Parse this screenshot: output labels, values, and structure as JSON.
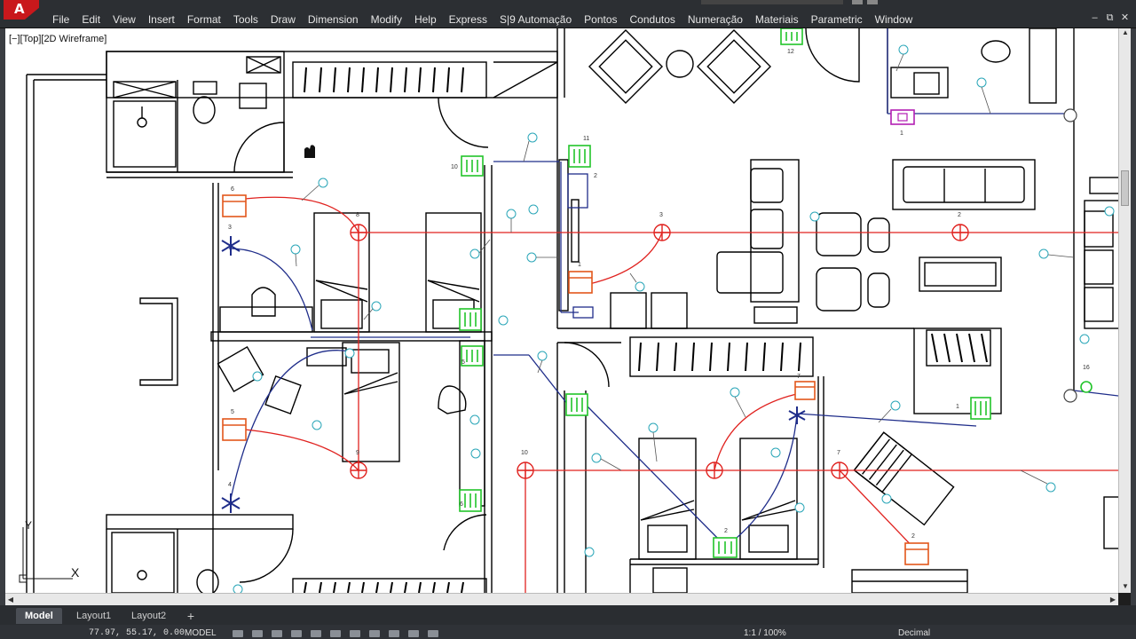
{
  "app": {
    "logo_letter": "A"
  },
  "menu": [
    "File",
    "Edit",
    "View",
    "Insert",
    "Format",
    "Tools",
    "Draw",
    "Dimension",
    "Modify",
    "Help",
    "Express",
    "S|9 Automação",
    "Pontos",
    "Condutos",
    "Numeração",
    "Materiais",
    "Parametric",
    "Window"
  ],
  "window_controls": {
    "minimize": "–",
    "restore": "⧉",
    "close": "✕"
  },
  "viewport": {
    "label": "[−][Top][2D Wireframe]"
  },
  "ucs": {
    "x": "X",
    "y": "Y"
  },
  "tags": {
    "t11": "11",
    "t12": "12",
    "t10": "10",
    "t6": "6",
    "t3a": "3",
    "t3b": "3",
    "t2a": "2",
    "t2b": "2",
    "t2c": "2",
    "t2d": "2",
    "t1a": "1",
    "t1b": "1",
    "t1c": "1",
    "t5": "5",
    "t4": "4",
    "t7a": "7",
    "t7b": "7",
    "t8": "8",
    "t9": "9",
    "t16": "16",
    "t10b": "10",
    "t5b": "5",
    "t6b": "6"
  },
  "layout_tabs": {
    "model": "Model",
    "layout1": "Layout1",
    "layout2": "Layout2",
    "add": "+"
  },
  "status": {
    "coords": "77.97, 55.17, 0.00",
    "model": "MODEL",
    "zoom": "1:1 / 100%",
    "units": "Decimal"
  },
  "colors": {
    "circuit_red": "#e0221f",
    "conduit_blue": "#1f2d8a",
    "switch_green": "#22c42a",
    "outlet_orange": "#e2561b",
    "label_cyan": "#2aa6b8"
  }
}
